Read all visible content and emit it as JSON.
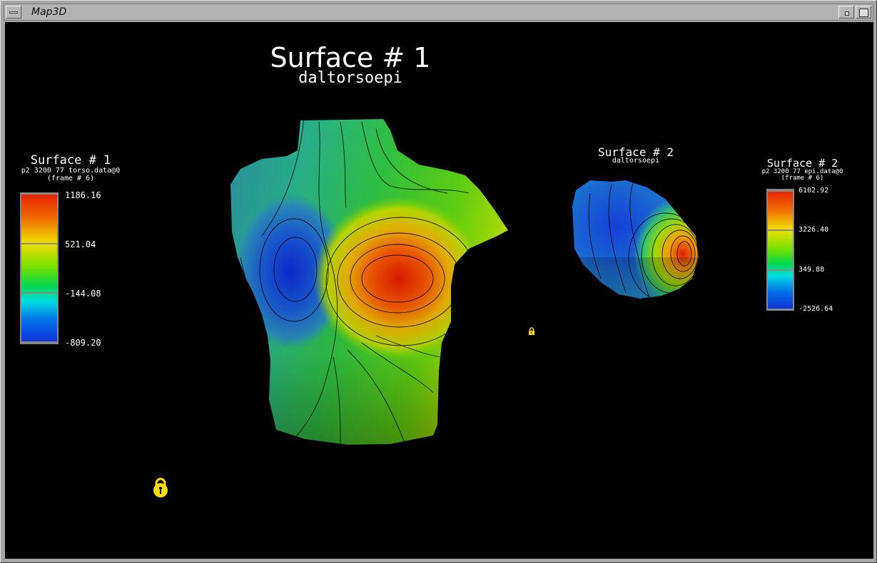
{
  "window": {
    "title": "Map3D"
  },
  "main_view": {
    "title": "Surface # 1",
    "subtitle": "daltorsoepi"
  },
  "secondary_view": {
    "title": "Surface # 2",
    "subtitle": "daltorsoepi"
  },
  "legend1": {
    "title": "Surface # 1",
    "file": "p2 3200 77 torso.data@0",
    "frame": "(frame # 6)",
    "ticks": [
      "1186.16",
      "521.04",
      "-144.08",
      "-809.20"
    ]
  },
  "legend2": {
    "title": "Surface # 2",
    "file": "p2 3200 77 epi.data@0",
    "frame": "(frame # 6)",
    "ticks": [
      "6102.92",
      "3226.40",
      "349.88",
      "-2526.64"
    ]
  },
  "colors": {
    "background": "#000000",
    "lock": "#ffdd00"
  },
  "icons": [
    "menu-icon",
    "minimize-icon",
    "maximize-icon",
    "lock-icon"
  ]
}
